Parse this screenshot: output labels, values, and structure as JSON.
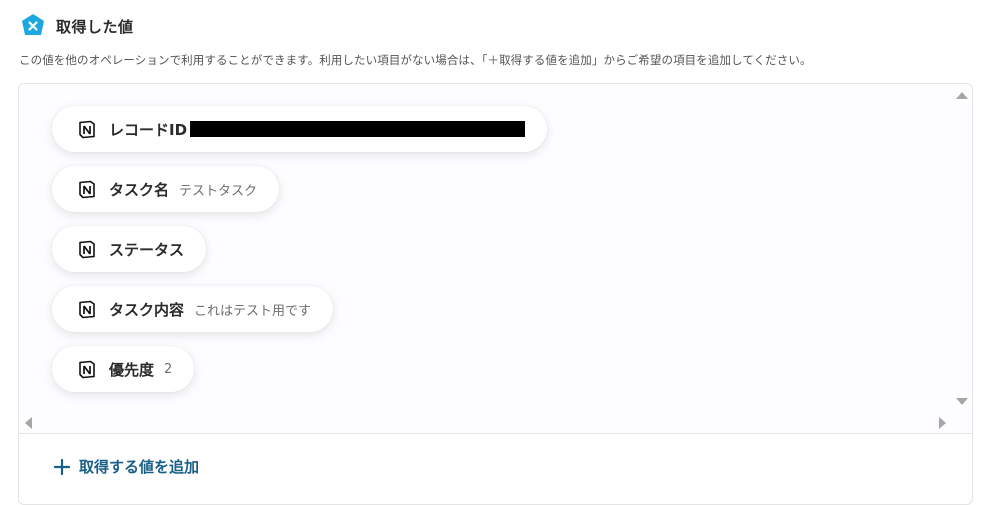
{
  "header": {
    "title": "取得した値",
    "icon": "close-badge-icon",
    "accent": "#1ba7e0"
  },
  "description": "この値を他のオペレーションで利用することができます。利用したい項目がない場合は、「＋取得する値を追加」からご希望の項目を追加してください。",
  "items": [
    {
      "label": "レコードID",
      "value": "",
      "redacted": true,
      "icon": "notion-icon"
    },
    {
      "label": "タスク名",
      "value": "テストタスク",
      "icon": "notion-icon"
    },
    {
      "label": "ステータス",
      "value": "",
      "icon": "notion-icon"
    },
    {
      "label": "タスク内容",
      "value": "これはテスト用です",
      "icon": "notion-icon"
    },
    {
      "label": "優先度",
      "value": "2",
      "icon": "notion-icon"
    }
  ],
  "add_button": {
    "label": "取得する値を追加",
    "icon": "plus-icon",
    "color": "#1a5f86"
  }
}
